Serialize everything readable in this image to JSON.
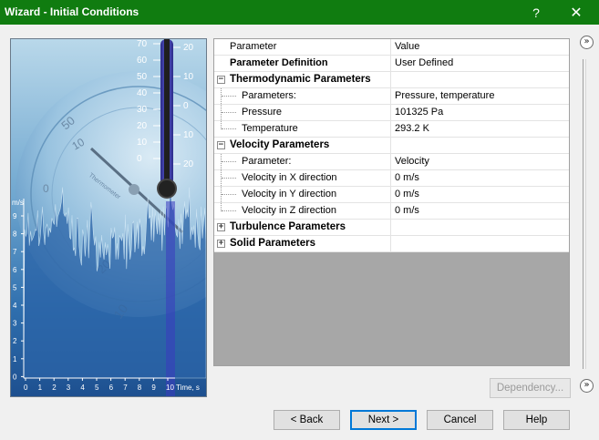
{
  "window": {
    "title": "Wizard - Initial Conditions",
    "help_glyph": "?",
    "close_glyph": "✕"
  },
  "illustration": {
    "thermometer_left_scale": [
      "70",
      "60",
      "50",
      "40",
      "30",
      "20",
      "10",
      "0"
    ],
    "thermometer_right_scale": [
      "20",
      "10",
      "0",
      "10",
      "20"
    ],
    "dial_labels": [
      "50",
      "10",
      "0",
      "10",
      "20",
      "10",
      "10"
    ],
    "dial_text": "Thermometer",
    "chart_y_unit": "m/s",
    "chart_y_ticks": [
      "9",
      "8",
      "7",
      "6",
      "5",
      "4",
      "3",
      "2",
      "1",
      "0"
    ],
    "chart_x_ticks": [
      "0",
      "1",
      "2",
      "3",
      "4",
      "5",
      "6",
      "7",
      "8",
      "9",
      "10"
    ],
    "chart_x_unit": "Time, s"
  },
  "grid": {
    "header": {
      "param": "Parameter",
      "value": "Value"
    },
    "rows": [
      {
        "kind": "bold",
        "label": "Parameter Definition",
        "value": "User Defined"
      },
      {
        "kind": "group",
        "label": "Thermodynamic Parameters",
        "value": "",
        "expander": "−"
      },
      {
        "kind": "child",
        "label": "Parameters:",
        "value": "Pressure, temperature"
      },
      {
        "kind": "child",
        "label": "Pressure",
        "value": "101325 Pa"
      },
      {
        "kind": "child",
        "label": "Temperature",
        "value": "293.2 K"
      },
      {
        "kind": "group",
        "label": "Velocity Parameters",
        "value": "",
        "expander": "−"
      },
      {
        "kind": "child",
        "label": "Parameter:",
        "value": "Velocity"
      },
      {
        "kind": "child",
        "label": "Velocity in X direction",
        "value": "0 m/s"
      },
      {
        "kind": "child",
        "label": "Velocity in Y direction",
        "value": "0 m/s"
      },
      {
        "kind": "child",
        "label": "Velocity in Z direction",
        "value": "0 m/s"
      },
      {
        "kind": "group",
        "label": "Turbulence Parameters",
        "value": "",
        "expander": "+"
      },
      {
        "kind": "group",
        "label": "Solid Parameters",
        "value": "",
        "expander": "+"
      }
    ]
  },
  "nav": {
    "scroll_up_glyph": "»",
    "scroll_down_glyph": "»"
  },
  "buttons": {
    "dependency": "Dependency...",
    "back": "< Back",
    "next": "Next >",
    "cancel": "Cancel",
    "help": "Help"
  },
  "colors": {
    "titlebar": "#107c10",
    "illustration_blue": "#3f7fb8",
    "grid_empty": "#a7a7a7",
    "default_button_border": "#0078d7"
  }
}
